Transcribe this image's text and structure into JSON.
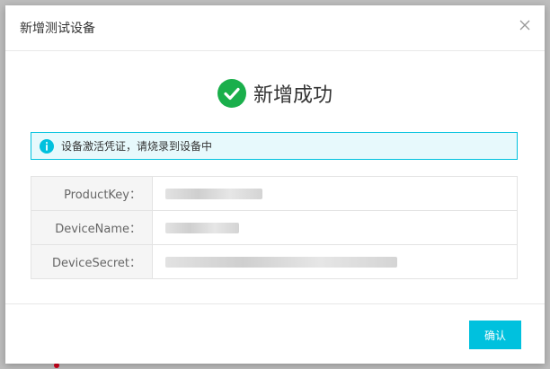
{
  "dialog": {
    "title": "新增测试设备",
    "success_message": "新增成功",
    "info_message": "设备激活凭证，请烧录到设备中",
    "fields": [
      {
        "label": "ProductKey："
      },
      {
        "label": "DeviceName："
      },
      {
        "label": "DeviceSecret："
      }
    ],
    "confirm_label": "确认"
  },
  "colors": {
    "accent": "#00c1de",
    "success": "#1aaf4b",
    "info_bg": "#e7f9fc"
  },
  "icons": {
    "close": "close-icon",
    "success": "check-circle-icon",
    "info": "info-icon"
  }
}
